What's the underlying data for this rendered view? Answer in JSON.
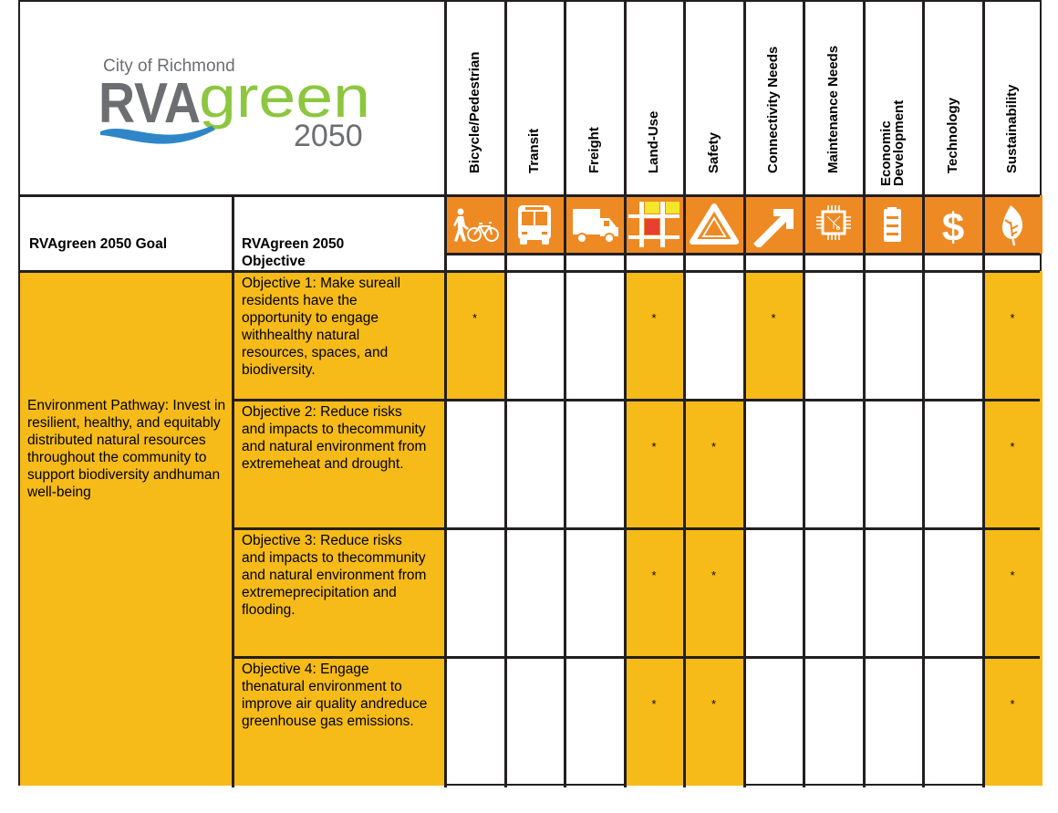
{
  "logo": {
    "city": "City of Richmond",
    "brand_rva": "RVA",
    "brand_green": "green",
    "year": "2050",
    "colors": {
      "gray": "#6d6e71",
      "green": "#8dc63f",
      "blue": "#2e86c8"
    }
  },
  "headers": {
    "goal": "RVAgreen 2050 Goal",
    "objective": "RVAgreen 2050 Objective"
  },
  "columns": [
    {
      "label": "Bicycle/Pedestrian",
      "icon": "pedestrian-bicycle-icon"
    },
    {
      "label": "Transit",
      "icon": "bus-icon"
    },
    {
      "label": "Freight",
      "icon": "truck-icon"
    },
    {
      "label": "Land-Use",
      "icon": "land-use-grid-icon"
    },
    {
      "label": "Safety",
      "icon": "warning-triangle-icon"
    },
    {
      "label": "Connectivity Needs",
      "icon": "arrow-up-right-icon"
    },
    {
      "label": "Maintenance Needs",
      "icon": "circuit-chip-icon"
    },
    {
      "label": "Economic Development",
      "icon": "battery-icon"
    },
    {
      "label": "Technology",
      "icon": "dollar-icon"
    },
    {
      "label": "Sustainability",
      "icon": "leaf-icon"
    }
  ],
  "goal": "Environment Pathway: Invest in resilient, healthy, and equitably distributed natural resources throughout the community to support biodiversity andhuman well-being",
  "rows": [
    {
      "objective": "Objective 1: Make sureall residents have the opportunity to engage withhealthy natural resources, spaces, and biodiversity.",
      "marks": [
        true,
        false,
        false,
        true,
        false,
        true,
        false,
        false,
        false,
        true
      ]
    },
    {
      "objective": "Objective 2: Reduce risks and impacts to thecommunity and natural environment from extremeheat and drought.",
      "marks": [
        false,
        false,
        false,
        true,
        true,
        false,
        false,
        false,
        false,
        true
      ]
    },
    {
      "objective": "Objective 3: Reduce risks and impacts to thecommunity and natural environment from extremeprecipitation and flooding.",
      "marks": [
        false,
        false,
        false,
        true,
        true,
        false,
        false,
        false,
        false,
        true
      ]
    },
    {
      "objective": "Objective 4: Engage thenatural environment to improve air quality andreduce greenhouse gas emissions.",
      "marks": [
        false,
        false,
        false,
        true,
        true,
        false,
        false,
        false,
        false,
        true
      ]
    }
  ],
  "mark_symbol": "*",
  "colors": {
    "highlight": "#f6bb18",
    "icon_band": "#ee8a23",
    "border": "#231f20"
  }
}
